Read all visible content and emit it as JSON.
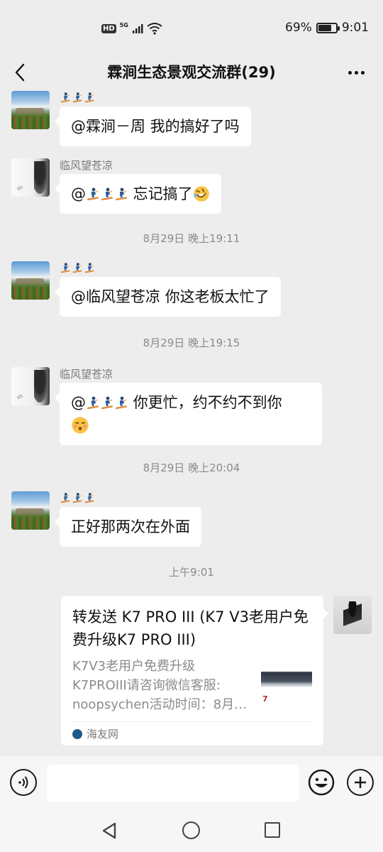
{
  "status_bar": {
    "network_badge": "HD",
    "network_type": "5G",
    "battery_text": "69%",
    "battery_level": 0.69,
    "time": "9:01"
  },
  "header": {
    "title": "霖涧生态景观交流群(29)"
  },
  "messages": [
    {
      "sender": "",
      "text": "@霖涧－周  我的搞好了吗"
    },
    {
      "sender": "临风望苍凉",
      "mention": "@",
      "text": " 忘记搞了"
    },
    {
      "timestamp": "8月29日 晚上19:11"
    },
    {
      "sender": "",
      "text": "@临风望苍凉  你这老板太忙了"
    },
    {
      "timestamp": "8月29日 晚上19:15"
    },
    {
      "sender": "临风望苍凉",
      "mention": "@",
      "text": " 你更忙，约不约不到你"
    },
    {
      "timestamp": "8月29日 晚上20:04"
    },
    {
      "sender": "",
      "text": "正好那两次在外面"
    },
    {
      "timestamp": "上午9:01"
    }
  ],
  "share_card": {
    "title": "转发送 K7 PRO III (K7 V3老用户免费升级K7 PRO III)",
    "desc_lines": [
      "K7V3老用户免费升级",
      "K7PROIII请咨询微信客服:",
      "noopsychen活动时间：8月…"
    ],
    "thumb_text": "7",
    "source": "海友网"
  },
  "icons": {
    "back": "chevron-left-icon",
    "more": "more-dots-icon",
    "voice": "voice-icon",
    "emoji": "emoji-icon",
    "plus": "plus-icon",
    "sender_emoji": "snowboarder-emoji",
    "cry_laugh": "rolling-laugh-emoji",
    "relieved": "relieved-emoji"
  },
  "colors": {
    "background": "#ededed",
    "bubble": "#ffffff",
    "text": "#111111",
    "secondary": "#8a8a8a"
  }
}
